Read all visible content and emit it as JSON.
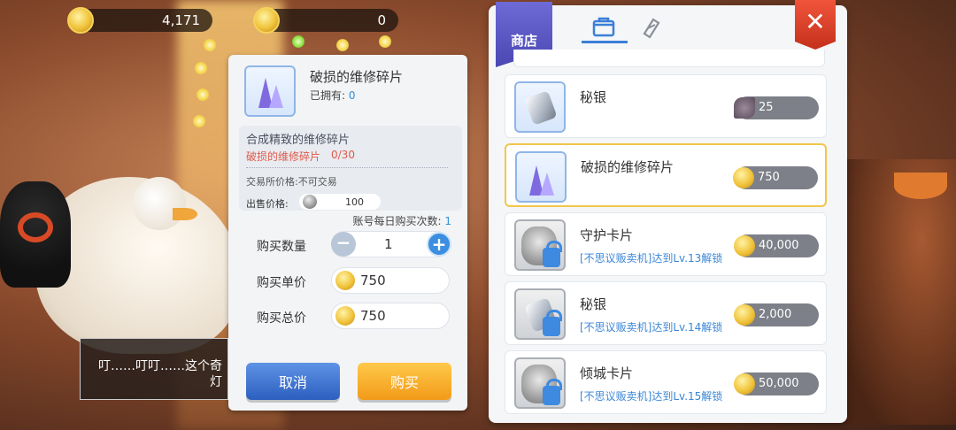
{
  "currency": {
    "gold": "4,171",
    "special": "0"
  },
  "purchase": {
    "item_name": "破损的维修碎片",
    "owned_label": "已拥有:",
    "owned_value": "0",
    "recipe_title": "合成精致的维修碎片",
    "recipe_material": "破损的维修碎片",
    "recipe_count": "0/30",
    "exchange_label": "交易所价格:不可交易",
    "sell_label": "出售价格:",
    "sell_value": "100",
    "daily_label": "账号每日购买次数:",
    "daily_value": "1",
    "qty_label": "购买数量",
    "qty_value": "1",
    "unit_label": "购买单价",
    "unit_value": "750",
    "total_label": "购买总价",
    "total_value": "750",
    "cancel": "取消",
    "buy": "购买"
  },
  "dialogue": {
    "line1": "叮……叮叮……这个奇",
    "line2": "灯"
  },
  "shop": {
    "badge": "商店",
    "close": "✕",
    "items": [
      {
        "name": "秘银",
        "price": "25",
        "unlock": "",
        "locked": false,
        "selected": false
      },
      {
        "name": "破损的维修碎片",
        "price": "750",
        "unlock": "",
        "locked": false,
        "selected": true
      },
      {
        "name": "守护卡片",
        "price": "40,000",
        "unlock": "[不思议贩卖机]达到Lv.13解锁",
        "locked": true,
        "selected": false
      },
      {
        "name": "秘银",
        "price": "2,000",
        "unlock": "[不思议贩卖机]达到Lv.14解锁",
        "locked": true,
        "selected": false
      },
      {
        "name": "倾城卡片",
        "price": "50,000",
        "unlock": "[不思议贩卖机]达到Lv.15解锁",
        "locked": true,
        "selected": false
      }
    ]
  }
}
